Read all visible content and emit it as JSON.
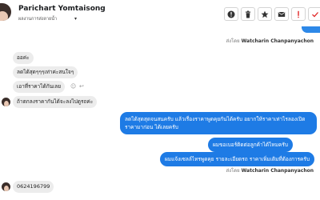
{
  "header": {
    "contact_name": "Parichart Yomtaisong",
    "contact_subtitle": "ผลงานการส่งลายน้ำ",
    "caret": "▾",
    "buttons": [
      {
        "name": "info",
        "icon": "info-icon"
      },
      {
        "name": "delete",
        "icon": "trash-icon"
      },
      {
        "name": "star",
        "icon": "star-icon"
      },
      {
        "name": "mail",
        "icon": "envelope-icon"
      },
      {
        "name": "spam",
        "icon": "exclamation-icon"
      },
      {
        "name": "more",
        "icon": "check-icon"
      }
    ]
  },
  "conversation": {
    "sent_by_1": {
      "prefix": "ส่งโดย",
      "name": "Watcharin Chanpanyachon"
    },
    "incoming": [
      "ออค่ะ",
      "ลดได้สุดๆๆๆเท่าค่ะสนใจๆ",
      "เอาที่ราคาได้กันเลย",
      "ถ้าตกลงราคากันได้จะลงไปดูรถค่ะ"
    ],
    "outgoing": [
      "ลดได้สุดสุดจนสนครับ แล้วเรื่องราคาพูดคุยกันได้ครับ อยากให้ราคาเท่าไรลองเปิดราคามาก่อน ได้เลยครับ",
      "ผมขอเบอร์ติดต่อลูกค้าได้ไหมครับ",
      "ผมแจ้งเซลล์ไทรพูดคุย รายละเอียดรถ ราคาเพิ่มเติมที่ต้องการครับ"
    ],
    "sent_by_2": {
      "prefix": "ส่งโดย",
      "name": "Watcharin Chanpanyachon"
    },
    "phone_message": "0624196799"
  },
  "colors": {
    "outgoing_bubble": "#1e7be5",
    "incoming_bubble": "#ececec"
  }
}
